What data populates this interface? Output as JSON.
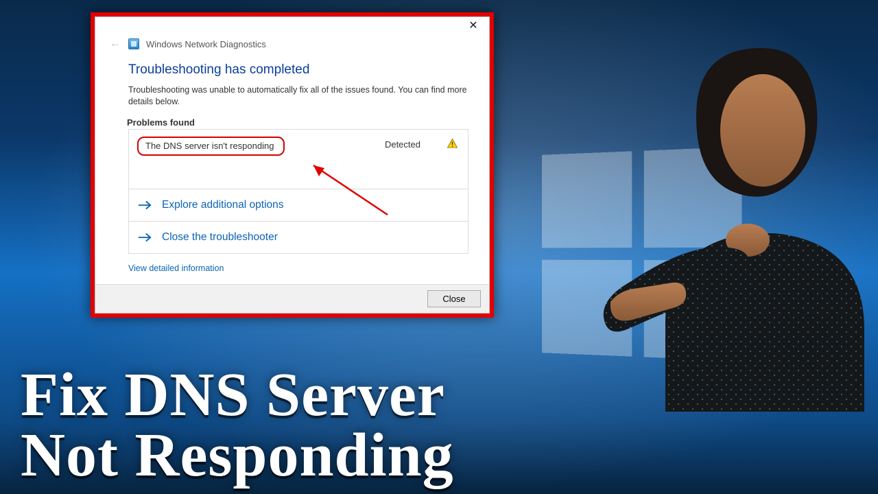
{
  "background": {
    "caption_line1": "Fix DNS Server",
    "caption_line2": "Not Responding"
  },
  "dialog": {
    "window_title": "Windows Network Diagnostics",
    "close_x": "✕",
    "heading": "Troubleshooting has completed",
    "description": "Troubleshooting was unable to automatically fix all of the issues found. You can find more details below.",
    "problems_label": "Problems found",
    "problem_text": "The DNS server isn't responding",
    "problem_status": "Detected",
    "option_explore": "Explore additional options",
    "option_close": "Close the troubleshooter",
    "detail_link": "View detailed information",
    "close_button": "Close"
  },
  "icons": {
    "back": "←",
    "option_arrow": "→"
  },
  "colors": {
    "frame_red": "#e20000",
    "link_blue": "#0a63b5",
    "heading_blue": "#0a3e9b"
  }
}
